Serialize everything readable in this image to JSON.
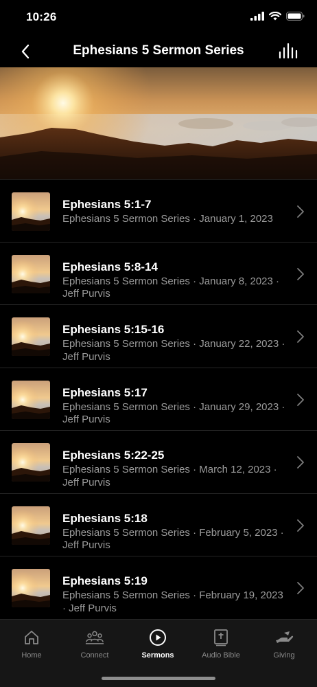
{
  "status_bar": {
    "time": "10:26"
  },
  "header": {
    "title": "Ephesians 5 Sermon Series"
  },
  "sermons": [
    {
      "title": "Ephesians 5:1-7",
      "subtitle": "Ephesians 5 Sermon Series · January 1, 2023"
    },
    {
      "title": "Ephesians 5:8-14",
      "subtitle": "Ephesians 5 Sermon Series · January 8, 2023 · Jeff Purvis"
    },
    {
      "title": "Ephesians 5:15-16",
      "subtitle": "Ephesians 5 Sermon Series · January 22, 2023 · Jeff Purvis"
    },
    {
      "title": "Ephesians 5:17",
      "subtitle": "Ephesians 5 Sermon Series · January 29, 2023 · Jeff Purvis"
    },
    {
      "title": "Ephesians 5:22-25",
      "subtitle": "Ephesians 5 Sermon Series · March 12, 2023 · Jeff Purvis"
    },
    {
      "title": "Ephesians 5:18",
      "subtitle": "Ephesians 5 Sermon Series · February 5, 2023 · Jeff Purvis"
    },
    {
      "title": "Ephesians 5:19",
      "subtitle": "Ephesians 5 Sermon Series · February 19, 2023 · Jeff Purvis"
    }
  ],
  "tabs": [
    {
      "label": "Home",
      "icon": "home-icon"
    },
    {
      "label": "Connect",
      "icon": "people-icon"
    },
    {
      "label": "Sermons",
      "icon": "play-circle-icon",
      "active": true
    },
    {
      "label": "Audio Bible",
      "icon": "bible-icon"
    },
    {
      "label": "Giving",
      "icon": "giving-hand-icon"
    }
  ],
  "colors": {
    "background": "#000000",
    "tab_bar": "#161616",
    "subtitle": "#9b9b9b",
    "inactive_tab": "#8a8a8a"
  }
}
